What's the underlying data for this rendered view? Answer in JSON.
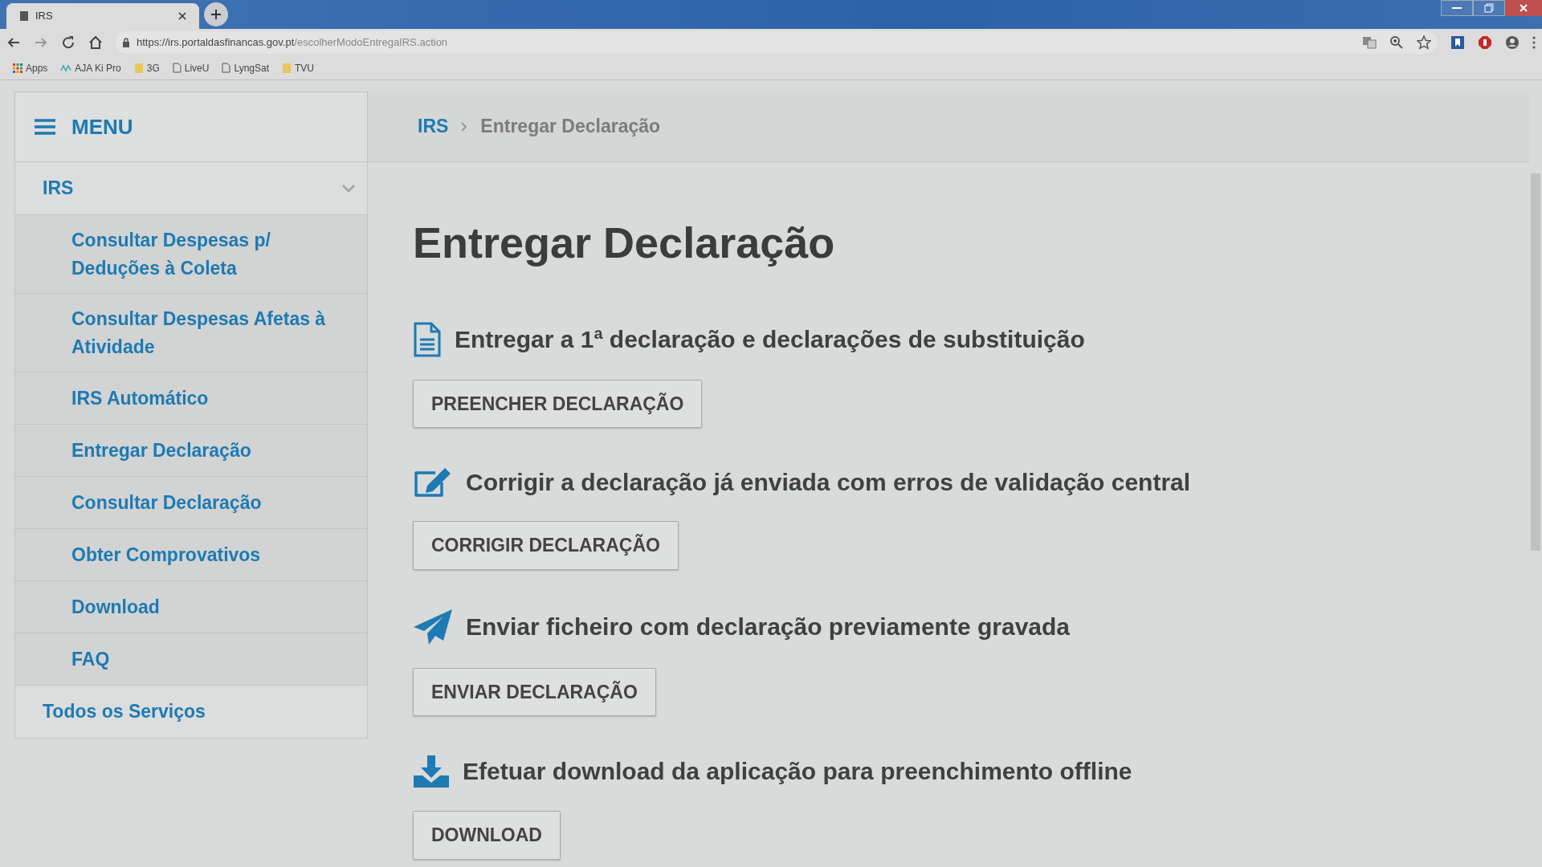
{
  "browser": {
    "tab_title": "IRS",
    "url_host": "https://irs.portaldasfinancas.gov.pt",
    "url_path": "/escolherModoEntregaIRS.action",
    "bookmarks": [
      {
        "kind": "apps",
        "label": "Apps"
      },
      {
        "kind": "aja",
        "label": "AJA Ki Pro"
      },
      {
        "kind": "folder",
        "label": "3G"
      },
      {
        "kind": "page",
        "label": "LiveU"
      },
      {
        "kind": "page",
        "label": "LyngSat"
      },
      {
        "kind": "folder",
        "label": "TVU"
      }
    ]
  },
  "menu_label": "MENU",
  "breadcrumb": [
    {
      "label": "IRS",
      "kind": "link"
    },
    {
      "label": "Entregar Declaração",
      "kind": "current"
    }
  ],
  "sidebar": [
    {
      "label": "IRS",
      "expanded": true,
      "children": [
        {
          "label": "Consultar Despesas p/ Deduções à Coleta"
        },
        {
          "label": "Consultar Despesas Afetas à Atividade"
        },
        {
          "label": "IRS Automático"
        },
        {
          "label": "Entregar Declaração"
        },
        {
          "label": "Consultar Declaração"
        },
        {
          "label": "Obter Comprovativos"
        },
        {
          "label": "Download"
        },
        {
          "label": "FAQ"
        }
      ]
    },
    {
      "label": "Todos os Serviços"
    }
  ],
  "title": "Entregar Declaração",
  "sections": [
    {
      "kind": "document",
      "heading": "Entregar a 1ª declaração e declarações de substituição",
      "button": "PREENCHER DECLARAÇÃO"
    },
    {
      "kind": "edit",
      "heading": "Corrigir a declaração já enviada com erros de validação central",
      "button": "CORRIGIR DECLARAÇÃO"
    },
    {
      "kind": "send",
      "heading": "Enviar ficheiro com declaração previamente gravada",
      "button": "ENVIAR DECLARAÇÃO"
    },
    {
      "kind": "download",
      "heading": "Efetuar download da aplicação para preenchimento offline",
      "button": "DOWNLOAD"
    }
  ]
}
